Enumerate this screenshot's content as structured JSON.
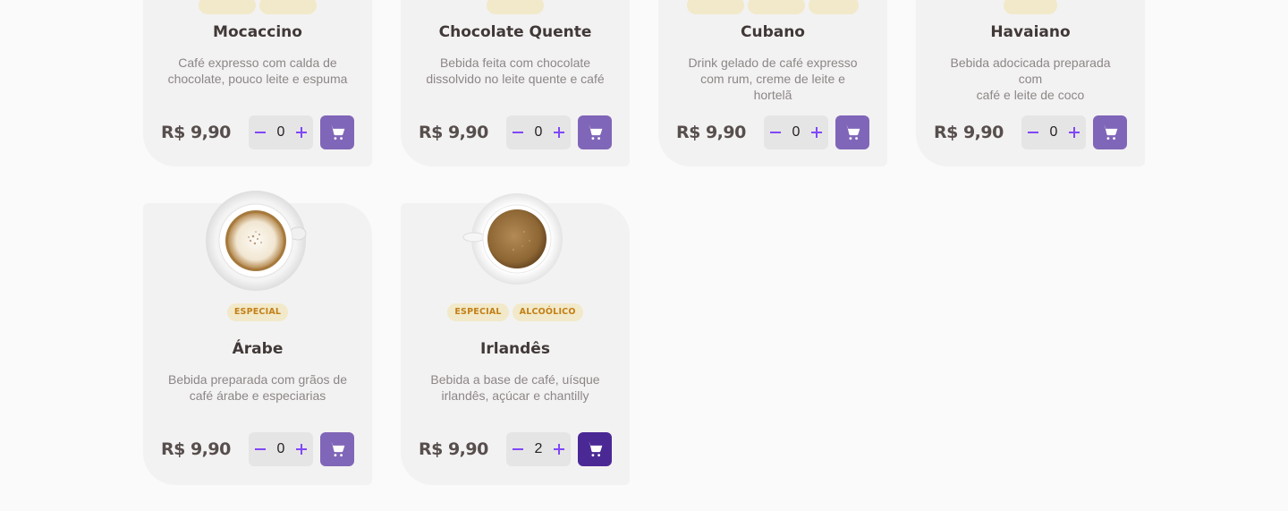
{
  "colors": {
    "accent": "#8066b8",
    "accent_dark": "#4b2995",
    "tag_bg": "#f1e9c9",
    "tag_text": "#c47f17"
  },
  "currency": "R$",
  "products": [
    {
      "name": "Mocaccino",
      "desc_l1": "Café expresso com calda de",
      "desc_l2": "chocolate, pouco leite e espuma",
      "price": "R$ 9,90",
      "qty": "0",
      "tags": []
    },
    {
      "name": "Chocolate Quente",
      "desc_l1": "Bebida feita com chocolate",
      "desc_l2": "dissolvido no leite quente e café",
      "price": "R$ 9,90",
      "qty": "0",
      "tags": []
    },
    {
      "name": "Cubano",
      "desc_l1": "Drink gelado de café expresso",
      "desc_l2": "com rum, creme de leite e hortelã",
      "price": "R$ 9,90",
      "qty": "0",
      "tags": []
    },
    {
      "name": "Havaiano",
      "desc_l1": "Bebida adocicada preparada com",
      "desc_l2": "café e leite de coco",
      "price": "R$ 9,90",
      "qty": "0",
      "tags": []
    },
    {
      "name": "Árabe",
      "desc_l1": "Bebida preparada com grãos de",
      "desc_l2": "café árabe e especiarias",
      "price": "R$ 9,90",
      "qty": "0",
      "tags": [
        "ESPECIAL"
      ]
    },
    {
      "name": "Irlandês",
      "desc_l1": "Bebida a base de café, uísque",
      "desc_l2": "irlandês, açúcar e chantilly",
      "price": "R$ 9,90",
      "qty": "2",
      "tags": [
        "ESPECIAL",
        "ALCOÓLICO"
      ]
    }
  ]
}
